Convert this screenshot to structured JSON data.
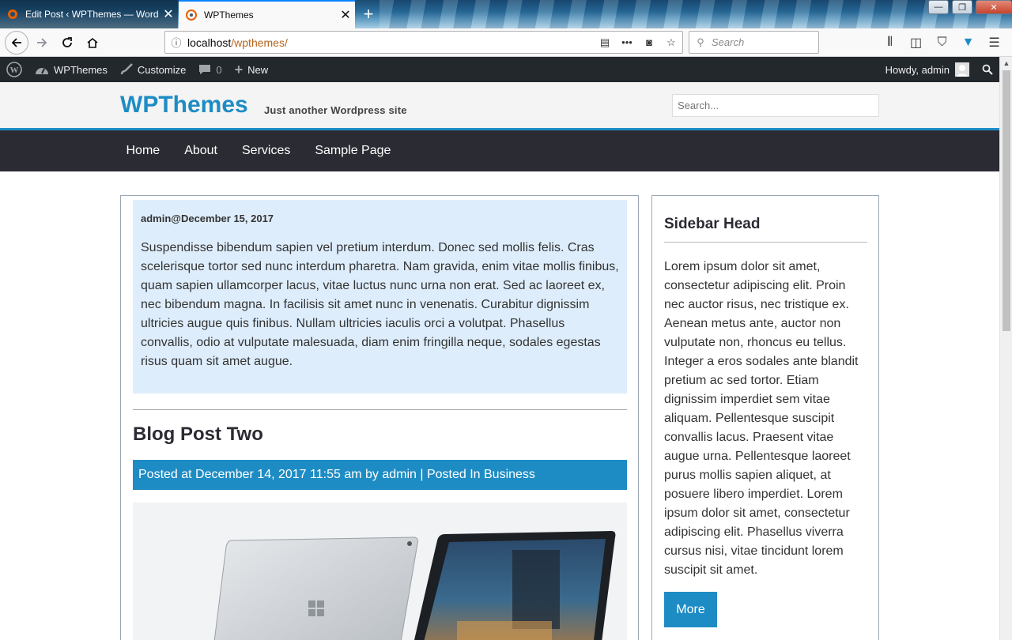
{
  "browser": {
    "tabs": [
      {
        "title": "Edit Post ‹ WPThemes — Word",
        "active": false
      },
      {
        "title": "WPThemes",
        "active": true
      }
    ],
    "url_host": "localhost",
    "url_path": "/wpthemes/",
    "search_placeholder": "Search"
  },
  "adminbar": {
    "site_name": "WPThemes",
    "customize": "Customize",
    "comments_count": "0",
    "new": "New",
    "howdy": "Howdy, admin"
  },
  "site": {
    "title": "WPThemes",
    "description": "Just another Wordpress site",
    "search_placeholder": "Search...",
    "nav": [
      "Home",
      "About",
      "Services",
      "Sample Page"
    ]
  },
  "post_one": {
    "meta": "admin@December 15, 2017",
    "body": "Suspendisse bibendum sapien vel pretium interdum. Donec sed mollis felis. Cras scelerisque tortor sed nunc interdum pharetra. Nam gravida, enim vitae mollis finibus, quam sapien ullamcorper lacus, vitae luctus nunc urna non erat. Sed ac laoreet ex, nec bibendum magna. In facilisis sit amet nunc in venenatis. Curabitur dignissim ultricies augue quis finibus. Nullam ultricies iaculis orci a volutpat. Phasellus convallis, odio at vulputate malesuada, diam enim fringilla neque, sodales egestas risus quam sit amet augue."
  },
  "post_two": {
    "title": "Blog Post Two",
    "meta": "Posted at December 14, 2017 11:55 am by admin | Posted In Business"
  },
  "sidebar": {
    "head": "Sidebar Head",
    "text": "Lorem ipsum dolor sit amet, consectetur adipiscing elit. Proin nec auctor risus, nec tristique ex. Aenean metus ante, auctor non vulputate non, rhoncus eu tellus. Integer a eros sodales ante blandit pretium ac sed tortor. Etiam dignissim imperdiet sem vitae aliquam. Pellentesque suscipit convallis lacus. Praesent vitae augue urna. Pellentesque laoreet purus mollis sapien aliquet, at posuere libero imperdiet. Lorem ipsum dolor sit amet, consectetur adipiscing elit. Phasellus viverra cursus nisi, vitae tincidunt lorem suscipit sit amet.",
    "more": "More"
  },
  "colors": {
    "accent": "#1e8cc4",
    "nav_bg": "#2b2b33",
    "admin_bg": "#23282d",
    "meta_box_bg": "#deedfc"
  }
}
